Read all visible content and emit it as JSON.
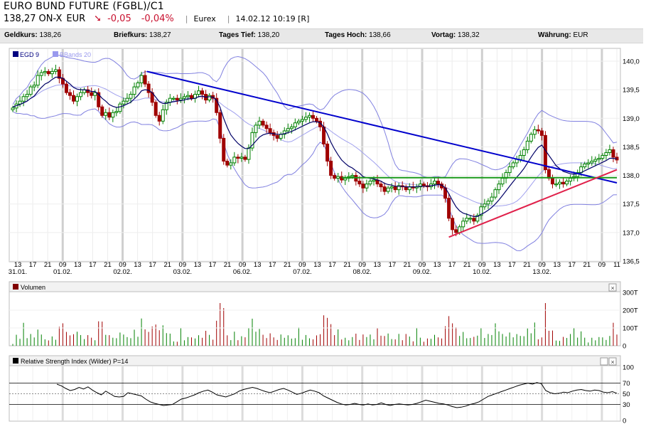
{
  "header": {
    "title": "EURO BUND FUTURE (FGBL)/C1",
    "price": "138,27",
    "qualifier": "ON-X",
    "currency": "EUR",
    "change": "-0,05",
    "change_pct": "-0,04%",
    "exchange": "Eurex",
    "timestamp": "14.02.12 10:19 [R]"
  },
  "infobar": [
    {
      "label": "Geldkurs:",
      "value": "138,26"
    },
    {
      "label": "Briefkurs:",
      "value": "138,27"
    },
    {
      "label": "Tages Tief:",
      "value": "138,20"
    },
    {
      "label": "Tages Hoch:",
      "value": "138,66"
    },
    {
      "label": "Vortag:",
      "value": "138,32"
    },
    {
      "label": "Währung:",
      "value": "EUR"
    }
  ],
  "colors": {
    "up": "#008000",
    "down": "#a00000",
    "ema": "#000066",
    "bands": "#7f7fe0",
    "trend_blue": "#0000cc",
    "support_green": "#1a9a1a",
    "trend_red": "#e0204a"
  },
  "chart_data": [
    {
      "type": "candlestick",
      "legend": [
        "EGD 9",
        "BBands 20"
      ],
      "ylim": [
        136.5,
        140.0
      ],
      "yticks": [
        "140,0",
        "139,5",
        "139,0",
        "138,5",
        "138,0",
        "137,5",
        "137,0",
        "136,5"
      ],
      "x_hour_labels": [
        "13",
        "17",
        "21",
        "09",
        "13",
        "17",
        "21",
        "09",
        "13",
        "17",
        "21",
        "09",
        "13",
        "17",
        "21",
        "09",
        "13",
        "17",
        "21",
        "09",
        "13",
        "17",
        "21",
        "09",
        "13",
        "17",
        "21",
        "09",
        "13",
        "17",
        "21",
        "09",
        "13",
        "17",
        "21",
        "09",
        "13",
        "17",
        "21",
        "09",
        "11"
      ],
      "x_date_labels": [
        "31.01.",
        "01.02.",
        "02.02.",
        "03.02.",
        "06.02.",
        "07.02.",
        "08.02.",
        "09.02.",
        "10.02.",
        "13.02."
      ],
      "close": [
        139.18,
        139.25,
        139.3,
        139.38,
        139.42,
        139.55,
        139.58,
        139.75,
        139.8,
        139.82,
        139.78,
        139.82,
        139.85,
        139.7,
        139.6,
        139.45,
        139.4,
        139.3,
        139.38,
        139.45,
        139.5,
        139.45,
        139.4,
        139.45,
        139.2,
        139.05,
        139.1,
        139.02,
        139.1,
        139.12,
        139.25,
        139.3,
        139.35,
        139.42,
        139.55,
        139.62,
        139.75,
        139.6,
        139.45,
        139.28,
        139.05,
        138.95,
        139.15,
        139.28,
        139.35,
        139.35,
        139.32,
        139.35,
        139.38,
        139.4,
        139.35,
        139.42,
        139.48,
        139.42,
        139.32,
        139.4,
        139.35,
        139.1,
        138.65,
        138.25,
        138.18,
        138.22,
        138.32,
        138.3,
        138.32,
        138.28,
        138.48,
        138.75,
        138.88,
        138.95,
        138.88,
        138.82,
        138.75,
        138.7,
        138.65,
        138.72,
        138.78,
        138.82,
        138.85,
        138.92,
        138.95,
        138.98,
        139.02,
        139.05,
        139.0,
        138.95,
        138.85,
        138.55,
        138.25,
        138.0,
        137.95,
        137.98,
        137.92,
        137.95,
        137.98,
        138.0,
        137.9,
        137.85,
        137.78,
        137.85,
        137.9,
        137.92,
        137.85,
        137.8,
        137.72,
        137.78,
        137.8,
        137.75,
        137.82,
        137.8,
        137.75,
        137.8,
        137.78,
        137.8,
        137.85,
        137.82,
        137.8,
        137.85,
        137.9,
        137.85,
        137.78,
        137.6,
        137.25,
        137.05,
        137.0,
        137.1,
        137.2,
        137.25,
        137.25,
        137.2,
        137.3,
        137.45,
        137.5,
        137.55,
        137.62,
        137.75,
        137.85,
        137.95,
        138.05,
        138.15,
        138.22,
        138.28,
        138.35,
        138.45,
        138.6,
        138.72,
        138.8,
        138.78,
        138.7,
        138.1,
        137.95,
        137.85,
        137.85,
        137.88,
        137.85,
        137.9,
        137.95,
        137.98,
        138.05,
        138.15,
        138.2,
        138.22,
        138.25,
        138.28,
        138.3,
        138.35,
        138.4,
        138.45,
        138.32,
        138.27
      ],
      "ema9": [
        139.2,
        139.22,
        139.24,
        139.27,
        139.3,
        139.35,
        139.39,
        139.47,
        139.54,
        139.6,
        139.63,
        139.68,
        139.72,
        139.72,
        139.7,
        139.65,
        139.6,
        139.54,
        139.51,
        139.5,
        139.5,
        139.49,
        139.47,
        139.47,
        139.42,
        139.35,
        139.3,
        139.24,
        139.21,
        139.19,
        139.2,
        139.22,
        139.25,
        139.28,
        139.34,
        139.4,
        139.48,
        139.5,
        139.49,
        139.45,
        139.37,
        139.29,
        139.26,
        139.26,
        139.28,
        139.29,
        139.3,
        139.31,
        139.32,
        139.34,
        139.34,
        139.35,
        139.38,
        139.39,
        139.37,
        139.38,
        139.37,
        139.32,
        139.19,
        139.0,
        138.84,
        138.71,
        138.63,
        138.56,
        138.51,
        138.47,
        138.47,
        138.53,
        138.6,
        138.67,
        138.71,
        138.73,
        138.74,
        138.73,
        138.72,
        138.72,
        138.73,
        138.75,
        138.77,
        138.8,
        138.83,
        138.86,
        138.89,
        138.92,
        138.94,
        138.94,
        138.92,
        138.85,
        138.73,
        138.58,
        138.46,
        138.36,
        138.27,
        138.21,
        138.16,
        138.13,
        138.08,
        138.04,
        137.98,
        137.96,
        137.95,
        137.94,
        137.92,
        137.9,
        137.86,
        137.84,
        137.83,
        137.81,
        137.81,
        137.81,
        137.8,
        137.8,
        137.8,
        137.8,
        137.81,
        137.81,
        137.81,
        137.82,
        137.83,
        137.84,
        137.83,
        137.78,
        137.68,
        137.56,
        137.45,
        137.38,
        137.34,
        137.32,
        137.3,
        137.28,
        137.28,
        137.32,
        137.35,
        137.39,
        137.44,
        137.5,
        137.57,
        137.65,
        137.73,
        137.81,
        137.89,
        137.97,
        138.04,
        138.12,
        138.22,
        138.32,
        138.41,
        138.49,
        138.53,
        138.44,
        138.35,
        138.26,
        138.17,
        138.12,
        138.07,
        138.05,
        138.03,
        138.02,
        138.03,
        138.05,
        138.08,
        138.11,
        138.14,
        138.17,
        138.2,
        138.23,
        138.26,
        138.3,
        138.3,
        138.29
      ]
    },
    {
      "type": "bar",
      "title": "Volumen",
      "yticks": [
        "300T",
        "200T",
        "100T",
        "0"
      ],
      "ylim": [
        0,
        300
      ]
    },
    {
      "type": "line",
      "title": "Relative Strength Index (Wilder) P=14",
      "yticks": [
        "100",
        "70",
        "50",
        "30",
        "0"
      ],
      "ylim": [
        0,
        100
      ],
      "values": [
        68,
        65,
        60,
        56,
        58,
        62,
        59,
        63,
        57,
        52,
        48,
        55,
        50,
        45,
        44,
        45,
        52,
        50,
        48,
        46,
        40,
        35,
        32,
        30,
        28,
        29,
        30,
        35,
        40,
        42,
        45,
        48,
        52,
        55,
        57,
        53,
        48,
        46,
        44,
        47,
        50,
        55,
        58,
        60,
        62,
        60,
        57,
        54,
        52,
        55,
        58,
        60,
        57,
        53,
        49,
        51,
        54,
        57,
        55,
        52,
        46,
        42,
        38,
        34,
        31,
        29,
        30,
        32,
        30,
        29,
        31,
        29,
        30,
        33,
        30,
        28,
        30,
        31,
        30,
        29,
        30,
        32,
        35,
        38,
        36,
        34,
        32,
        31,
        29,
        26,
        24,
        25,
        27,
        30,
        32,
        35,
        40,
        45,
        48,
        51,
        54,
        57,
        60,
        63,
        66,
        68,
        70,
        68,
        71,
        69,
        56,
        52,
        50,
        51,
        53,
        52,
        55,
        57,
        58,
        56,
        55,
        57,
        56,
        53,
        52,
        54,
        51
      ]
    }
  ],
  "panels": {
    "volume_close_label": "×",
    "rsi_close_label": "×"
  }
}
